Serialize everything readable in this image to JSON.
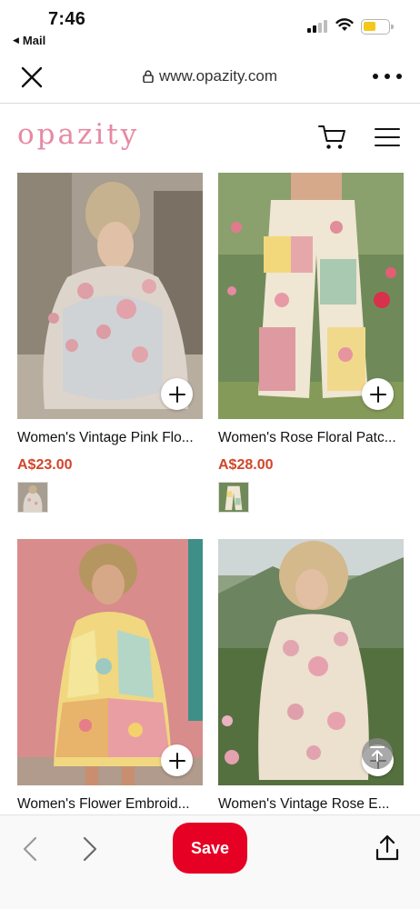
{
  "status_bar": {
    "time": "7:46",
    "back_app": "Mail"
  },
  "browser": {
    "url": "www.opazity.com",
    "close_icon": "close-icon",
    "more_icon": "more-dots-icon"
  },
  "site": {
    "logo": "opazity",
    "cart_icon": "cart-icon",
    "menu_icon": "hamburger-menu-icon",
    "logo_color": "#e68aa3"
  },
  "products": [
    {
      "name": "Women's Vintage Pink Flo...",
      "price": "A$23.00"
    },
    {
      "name": "Women's Rose Floral Patc...",
      "price": "A$28.00"
    },
    {
      "name": "Women's Flower Embroid...",
      "price": ""
    },
    {
      "name": "Women's Vintage Rose E...",
      "price": ""
    }
  ],
  "toolbar": {
    "save_label": "Save",
    "back_icon": "chevron-left-icon",
    "forward_icon": "chevron-right-icon",
    "share_icon": "share-icon",
    "accent": "#e60023"
  },
  "price_color": "#d2452a"
}
